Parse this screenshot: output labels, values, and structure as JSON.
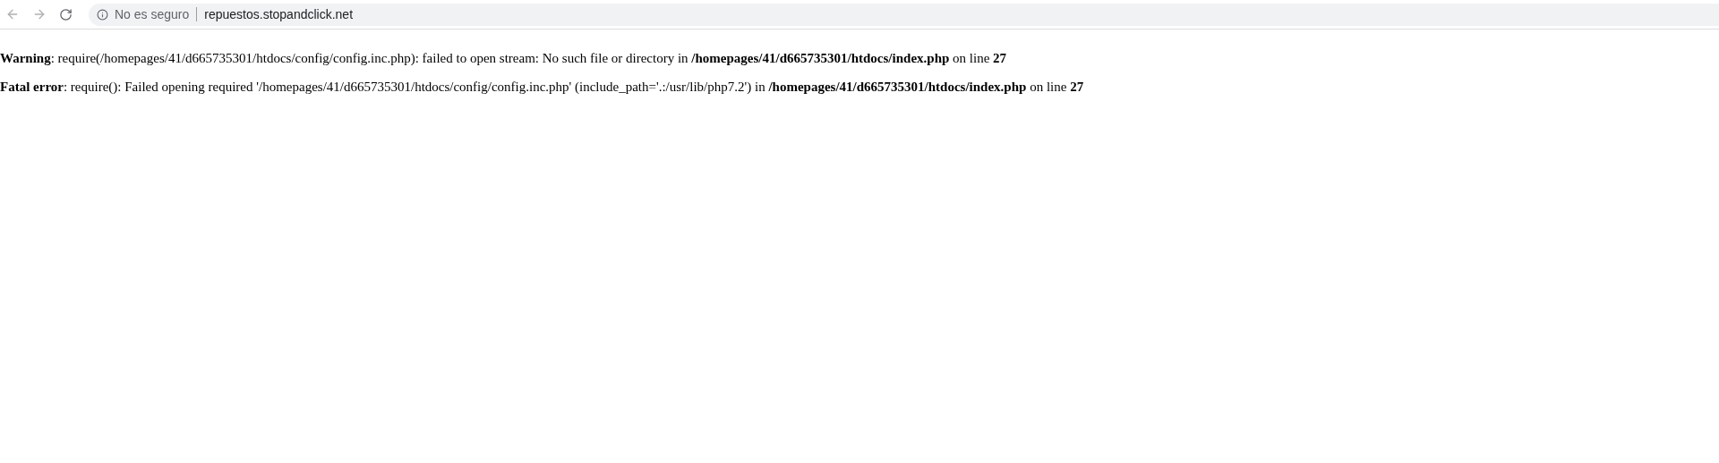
{
  "browser": {
    "security_label": "No es seguro",
    "url": "repuestos.stopandclick.net"
  },
  "messages": [
    {
      "text": "**Warning**: require(/homepages/41/d665735301/htdocs/config/config.inc.php): failed to open stream: No such file or directory in **/homepages/41/d665735301/htdocs/index.php** on line **27**"
    },
    {
      "text": "**Fatal error**: require(): Failed opening required '/homepages/41/d665735301/htdocs/config/config.inc.php' (include_path='.:/usr/lib/php7.2') in **/homepages/41/d665735301/htdocs/index.php** on line **27**"
    }
  ]
}
